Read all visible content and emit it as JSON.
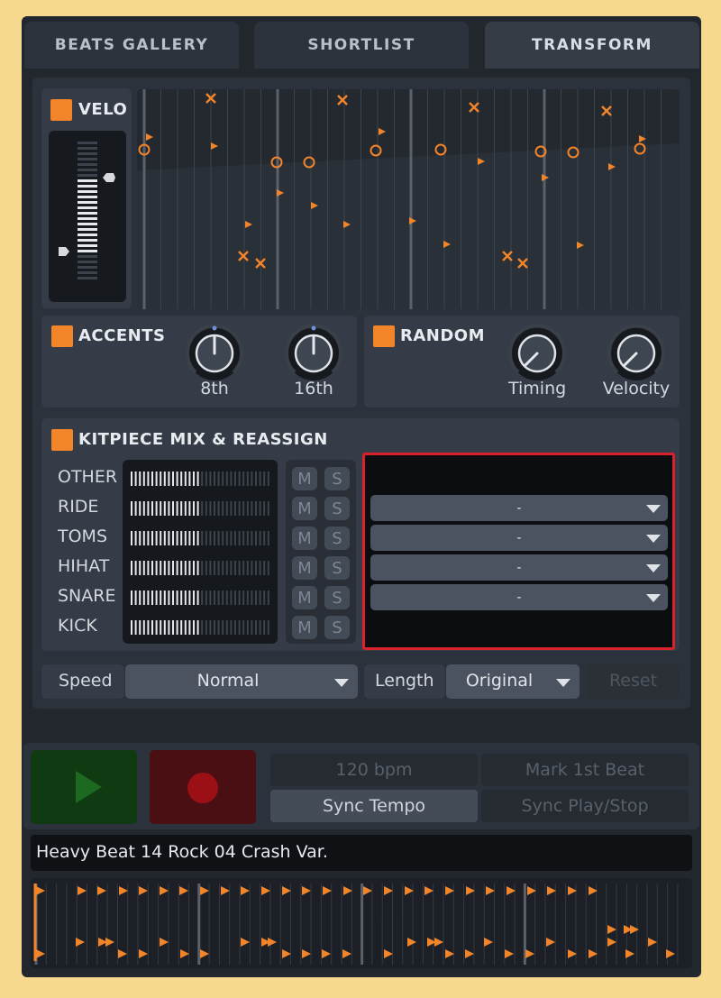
{
  "tabs": [
    {
      "label": "BEATS GALLERY",
      "active": false
    },
    {
      "label": "SHORTLIST",
      "active": false
    },
    {
      "label": "TRANSFORM",
      "active": true
    }
  ],
  "accent_color": "#f2842a",
  "velo": {
    "title": "VELO"
  },
  "accents": {
    "title": "ACCENTS",
    "knobs": [
      {
        "label": "8th"
      },
      {
        "label": "16th"
      }
    ]
  },
  "random": {
    "title": "RANDOM",
    "knobs": [
      {
        "label": "Timing"
      },
      {
        "label": "Velocity"
      }
    ]
  },
  "kitpiece": {
    "title": "KITPIECE MIX & REASSIGN",
    "rows": [
      {
        "label": "OTHER",
        "mute": "M",
        "solo": "S",
        "reassign": ""
      },
      {
        "label": "RIDE",
        "mute": "M",
        "solo": "S",
        "reassign": "-"
      },
      {
        "label": "TOMS",
        "mute": "M",
        "solo": "S",
        "reassign": "-"
      },
      {
        "label": "HIHAT",
        "mute": "M",
        "solo": "S",
        "reassign": "-"
      },
      {
        "label": "SNARE",
        "mute": "M",
        "solo": "S",
        "reassign": "-"
      },
      {
        "label": "KICK",
        "mute": "M",
        "solo": "S",
        "reassign": ""
      }
    ]
  },
  "footer": {
    "speed_label": "Speed",
    "speed_value": "Normal",
    "length_label": "Length",
    "length_value": "Original",
    "reset_label": "Reset"
  },
  "transport": {
    "bpm": "120 bpm",
    "mark_first_beat": "Mark 1st Beat",
    "sync_tempo": "Sync Tempo",
    "sync_play_stop": "Sync Play/Stop",
    "play_color": "#0f3a12",
    "record_color": "#4a0f12"
  },
  "beat_name": "Heavy Beat 14 Rock 04 Crash Var."
}
